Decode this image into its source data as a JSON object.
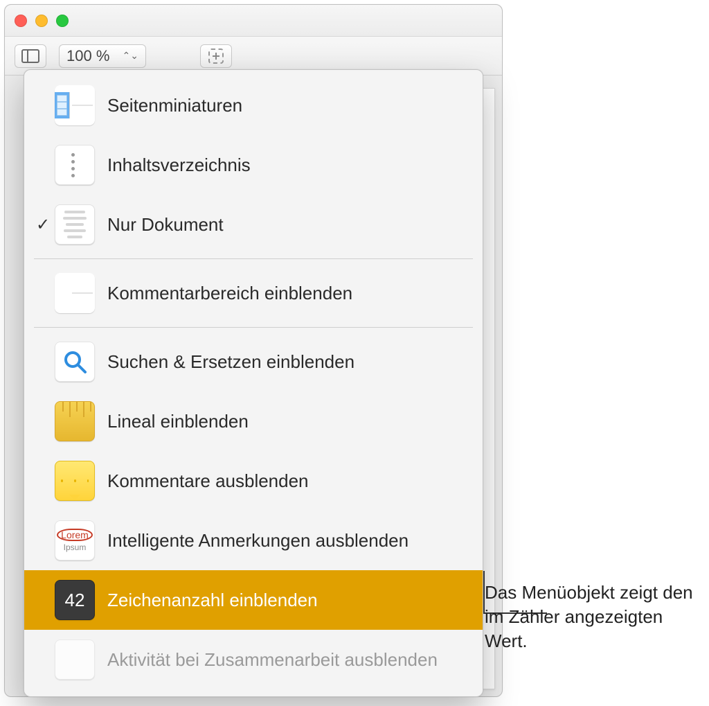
{
  "toolbar": {
    "zoom_value": "100 %"
  },
  "menu": {
    "items": [
      {
        "label": "Seitenminiaturen",
        "icon": "thumbnails-icon",
        "checked": false,
        "disabled": false
      },
      {
        "label": "Inhaltsverzeichnis",
        "icon": "toc-icon",
        "checked": false,
        "disabled": false
      },
      {
        "label": "Nur Dokument",
        "icon": "document-only-icon",
        "checked": true,
        "disabled": false
      },
      {
        "label": "Kommentarbereich einblenden",
        "icon": "comments-pane-icon",
        "checked": false,
        "disabled": false
      },
      {
        "label": "Suchen & Ersetzen einblenden",
        "icon": "search-icon",
        "checked": false,
        "disabled": false
      },
      {
        "label": "Lineal einblenden",
        "icon": "ruler-icon",
        "checked": false,
        "disabled": false
      },
      {
        "label": "Kommentare ausblenden",
        "icon": "comment-note-icon",
        "checked": false,
        "disabled": false
      },
      {
        "label": "Intelligente Anmerkungen ausblenden",
        "icon": "lorem-icon",
        "checked": false,
        "disabled": false
      },
      {
        "label": "Zeichenanzahl einblenden",
        "icon": "char-count-icon",
        "checked": false,
        "disabled": false,
        "highlight": true,
        "count": "42"
      },
      {
        "label": "Aktivität bei Zusammenarbeit ausblenden",
        "icon": "collab-icon",
        "checked": false,
        "disabled": true
      }
    ]
  },
  "callout": {
    "text": "Das Menüobjekt zeigt den im Zähler angezeigten Wert."
  }
}
